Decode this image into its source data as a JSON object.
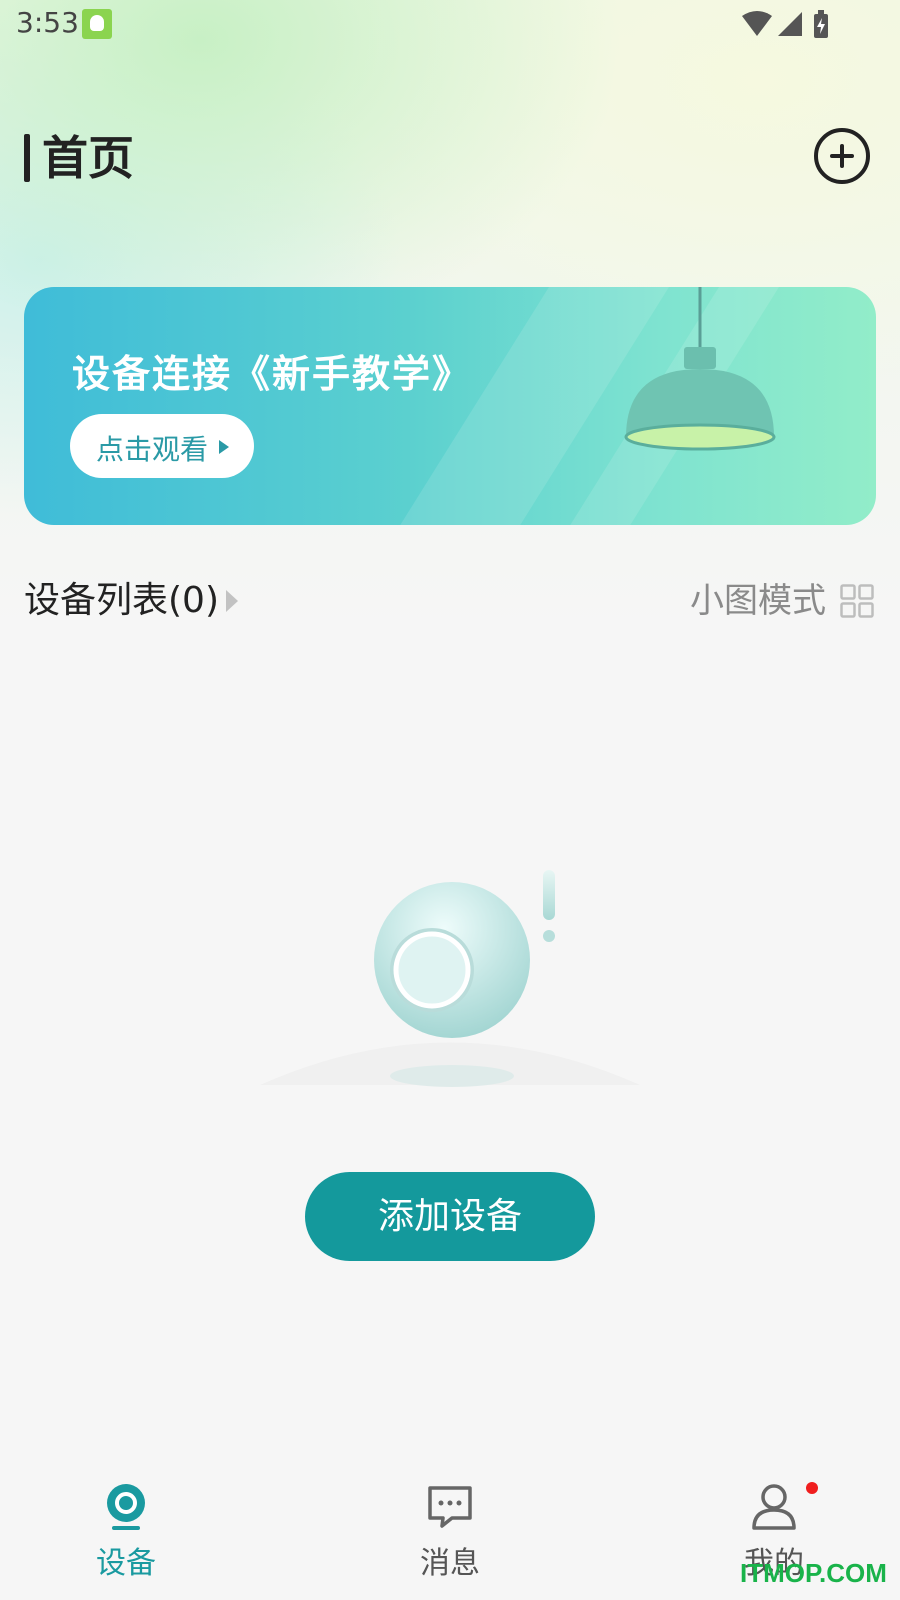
{
  "status_bar": {
    "time": "3:53"
  },
  "header": {
    "title": "首页"
  },
  "banner": {
    "title": "设备连接《新手教学》",
    "button_label": "点击观看"
  },
  "device_list": {
    "title": "设备列表(0)",
    "view_mode_label": "小图模式"
  },
  "empty_state": {
    "add_button_label": "添加设备"
  },
  "tabbar": {
    "items": [
      {
        "label": "设备",
        "active": true
      },
      {
        "label": "消息",
        "active": false
      },
      {
        "label": "我的",
        "active": false,
        "badge": true
      }
    ]
  },
  "watermark": "ITMOP.COM",
  "colors": {
    "accent": "#14999c",
    "tab_active": "#1a9aa0",
    "tab_inactive": "#666666",
    "badge": "#f01e1e"
  }
}
